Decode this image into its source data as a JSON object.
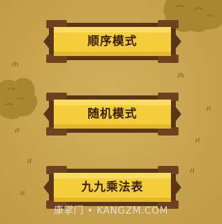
{
  "menu": {
    "buttons": [
      {
        "label": "顺序模式"
      },
      {
        "label": "随机模式"
      },
      {
        "label": "九九乘法表"
      }
    ]
  },
  "watermark": {
    "text": "康掌门 • KANGZM.COM"
  },
  "colors": {
    "background": "#c9a54f",
    "button_fill": "#f4ce3a",
    "button_border": "#5a3518",
    "bush": "#a98632",
    "label_text": "#3a2008"
  },
  "icons": {
    "bush_left": "bush-icon",
    "bush_right": "bush-icon"
  }
}
